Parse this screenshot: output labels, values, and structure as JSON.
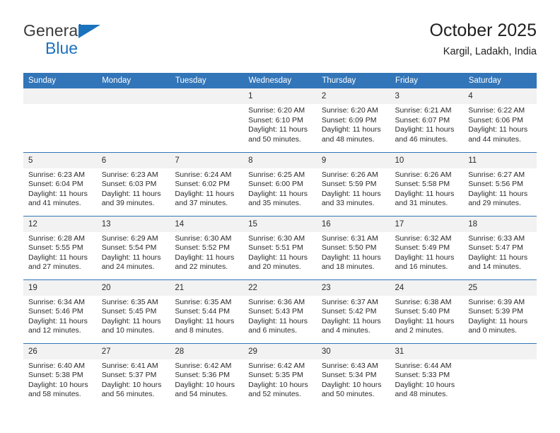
{
  "brand": {
    "line1": "General",
    "line2": "Blue",
    "triangle_color": "#1b72bd"
  },
  "header": {
    "title": "October 2025",
    "location": "Kargil, Ladakh, India"
  },
  "theme": {
    "header_blue": "#3275b8",
    "daynum_bg": "#f2f2f2",
    "text": "#2a2a2a"
  },
  "weekdays": [
    "Sunday",
    "Monday",
    "Tuesday",
    "Wednesday",
    "Thursday",
    "Friday",
    "Saturday"
  ],
  "labels": {
    "sunrise": "Sunrise:",
    "sunset": "Sunset:",
    "daylight": "Daylight:"
  },
  "weeks": [
    [
      {
        "day": "",
        "sunrise": "",
        "sunset": "",
        "daylight": "",
        "empty": true
      },
      {
        "day": "",
        "sunrise": "",
        "sunset": "",
        "daylight": "",
        "empty": true
      },
      {
        "day": "",
        "sunrise": "",
        "sunset": "",
        "daylight": "",
        "empty": true
      },
      {
        "day": "1",
        "sunrise": "Sunrise: 6:20 AM",
        "sunset": "Sunset: 6:10 PM",
        "daylight": "Daylight: 11 hours and 50 minutes."
      },
      {
        "day": "2",
        "sunrise": "Sunrise: 6:20 AM",
        "sunset": "Sunset: 6:09 PM",
        "daylight": "Daylight: 11 hours and 48 minutes."
      },
      {
        "day": "3",
        "sunrise": "Sunrise: 6:21 AM",
        "sunset": "Sunset: 6:07 PM",
        "daylight": "Daylight: 11 hours and 46 minutes."
      },
      {
        "day": "4",
        "sunrise": "Sunrise: 6:22 AM",
        "sunset": "Sunset: 6:06 PM",
        "daylight": "Daylight: 11 hours and 44 minutes."
      }
    ],
    [
      {
        "day": "5",
        "sunrise": "Sunrise: 6:23 AM",
        "sunset": "Sunset: 6:04 PM",
        "daylight": "Daylight: 11 hours and 41 minutes."
      },
      {
        "day": "6",
        "sunrise": "Sunrise: 6:23 AM",
        "sunset": "Sunset: 6:03 PM",
        "daylight": "Daylight: 11 hours and 39 minutes."
      },
      {
        "day": "7",
        "sunrise": "Sunrise: 6:24 AM",
        "sunset": "Sunset: 6:02 PM",
        "daylight": "Daylight: 11 hours and 37 minutes."
      },
      {
        "day": "8",
        "sunrise": "Sunrise: 6:25 AM",
        "sunset": "Sunset: 6:00 PM",
        "daylight": "Daylight: 11 hours and 35 minutes."
      },
      {
        "day": "9",
        "sunrise": "Sunrise: 6:26 AM",
        "sunset": "Sunset: 5:59 PM",
        "daylight": "Daylight: 11 hours and 33 minutes."
      },
      {
        "day": "10",
        "sunrise": "Sunrise: 6:26 AM",
        "sunset": "Sunset: 5:58 PM",
        "daylight": "Daylight: 11 hours and 31 minutes."
      },
      {
        "day": "11",
        "sunrise": "Sunrise: 6:27 AM",
        "sunset": "Sunset: 5:56 PM",
        "daylight": "Daylight: 11 hours and 29 minutes."
      }
    ],
    [
      {
        "day": "12",
        "sunrise": "Sunrise: 6:28 AM",
        "sunset": "Sunset: 5:55 PM",
        "daylight": "Daylight: 11 hours and 27 minutes."
      },
      {
        "day": "13",
        "sunrise": "Sunrise: 6:29 AM",
        "sunset": "Sunset: 5:54 PM",
        "daylight": "Daylight: 11 hours and 24 minutes."
      },
      {
        "day": "14",
        "sunrise": "Sunrise: 6:30 AM",
        "sunset": "Sunset: 5:52 PM",
        "daylight": "Daylight: 11 hours and 22 minutes."
      },
      {
        "day": "15",
        "sunrise": "Sunrise: 6:30 AM",
        "sunset": "Sunset: 5:51 PM",
        "daylight": "Daylight: 11 hours and 20 minutes."
      },
      {
        "day": "16",
        "sunrise": "Sunrise: 6:31 AM",
        "sunset": "Sunset: 5:50 PM",
        "daylight": "Daylight: 11 hours and 18 minutes."
      },
      {
        "day": "17",
        "sunrise": "Sunrise: 6:32 AM",
        "sunset": "Sunset: 5:49 PM",
        "daylight": "Daylight: 11 hours and 16 minutes."
      },
      {
        "day": "18",
        "sunrise": "Sunrise: 6:33 AM",
        "sunset": "Sunset: 5:47 PM",
        "daylight": "Daylight: 11 hours and 14 minutes."
      }
    ],
    [
      {
        "day": "19",
        "sunrise": "Sunrise: 6:34 AM",
        "sunset": "Sunset: 5:46 PM",
        "daylight": "Daylight: 11 hours and 12 minutes."
      },
      {
        "day": "20",
        "sunrise": "Sunrise: 6:35 AM",
        "sunset": "Sunset: 5:45 PM",
        "daylight": "Daylight: 11 hours and 10 minutes."
      },
      {
        "day": "21",
        "sunrise": "Sunrise: 6:35 AM",
        "sunset": "Sunset: 5:44 PM",
        "daylight": "Daylight: 11 hours and 8 minutes."
      },
      {
        "day": "22",
        "sunrise": "Sunrise: 6:36 AM",
        "sunset": "Sunset: 5:43 PM",
        "daylight": "Daylight: 11 hours and 6 minutes."
      },
      {
        "day": "23",
        "sunrise": "Sunrise: 6:37 AM",
        "sunset": "Sunset: 5:42 PM",
        "daylight": "Daylight: 11 hours and 4 minutes."
      },
      {
        "day": "24",
        "sunrise": "Sunrise: 6:38 AM",
        "sunset": "Sunset: 5:40 PM",
        "daylight": "Daylight: 11 hours and 2 minutes."
      },
      {
        "day": "25",
        "sunrise": "Sunrise: 6:39 AM",
        "sunset": "Sunset: 5:39 PM",
        "daylight": "Daylight: 11 hours and 0 minutes."
      }
    ],
    [
      {
        "day": "26",
        "sunrise": "Sunrise: 6:40 AM",
        "sunset": "Sunset: 5:38 PM",
        "daylight": "Daylight: 10 hours and 58 minutes."
      },
      {
        "day": "27",
        "sunrise": "Sunrise: 6:41 AM",
        "sunset": "Sunset: 5:37 PM",
        "daylight": "Daylight: 10 hours and 56 minutes."
      },
      {
        "day": "28",
        "sunrise": "Sunrise: 6:42 AM",
        "sunset": "Sunset: 5:36 PM",
        "daylight": "Daylight: 10 hours and 54 minutes."
      },
      {
        "day": "29",
        "sunrise": "Sunrise: 6:42 AM",
        "sunset": "Sunset: 5:35 PM",
        "daylight": "Daylight: 10 hours and 52 minutes."
      },
      {
        "day": "30",
        "sunrise": "Sunrise: 6:43 AM",
        "sunset": "Sunset: 5:34 PM",
        "daylight": "Daylight: 10 hours and 50 minutes."
      },
      {
        "day": "31",
        "sunrise": "Sunrise: 6:44 AM",
        "sunset": "Sunset: 5:33 PM",
        "daylight": "Daylight: 10 hours and 48 minutes."
      },
      {
        "day": "",
        "sunrise": "",
        "sunset": "",
        "daylight": "",
        "empty": true
      }
    ]
  ]
}
